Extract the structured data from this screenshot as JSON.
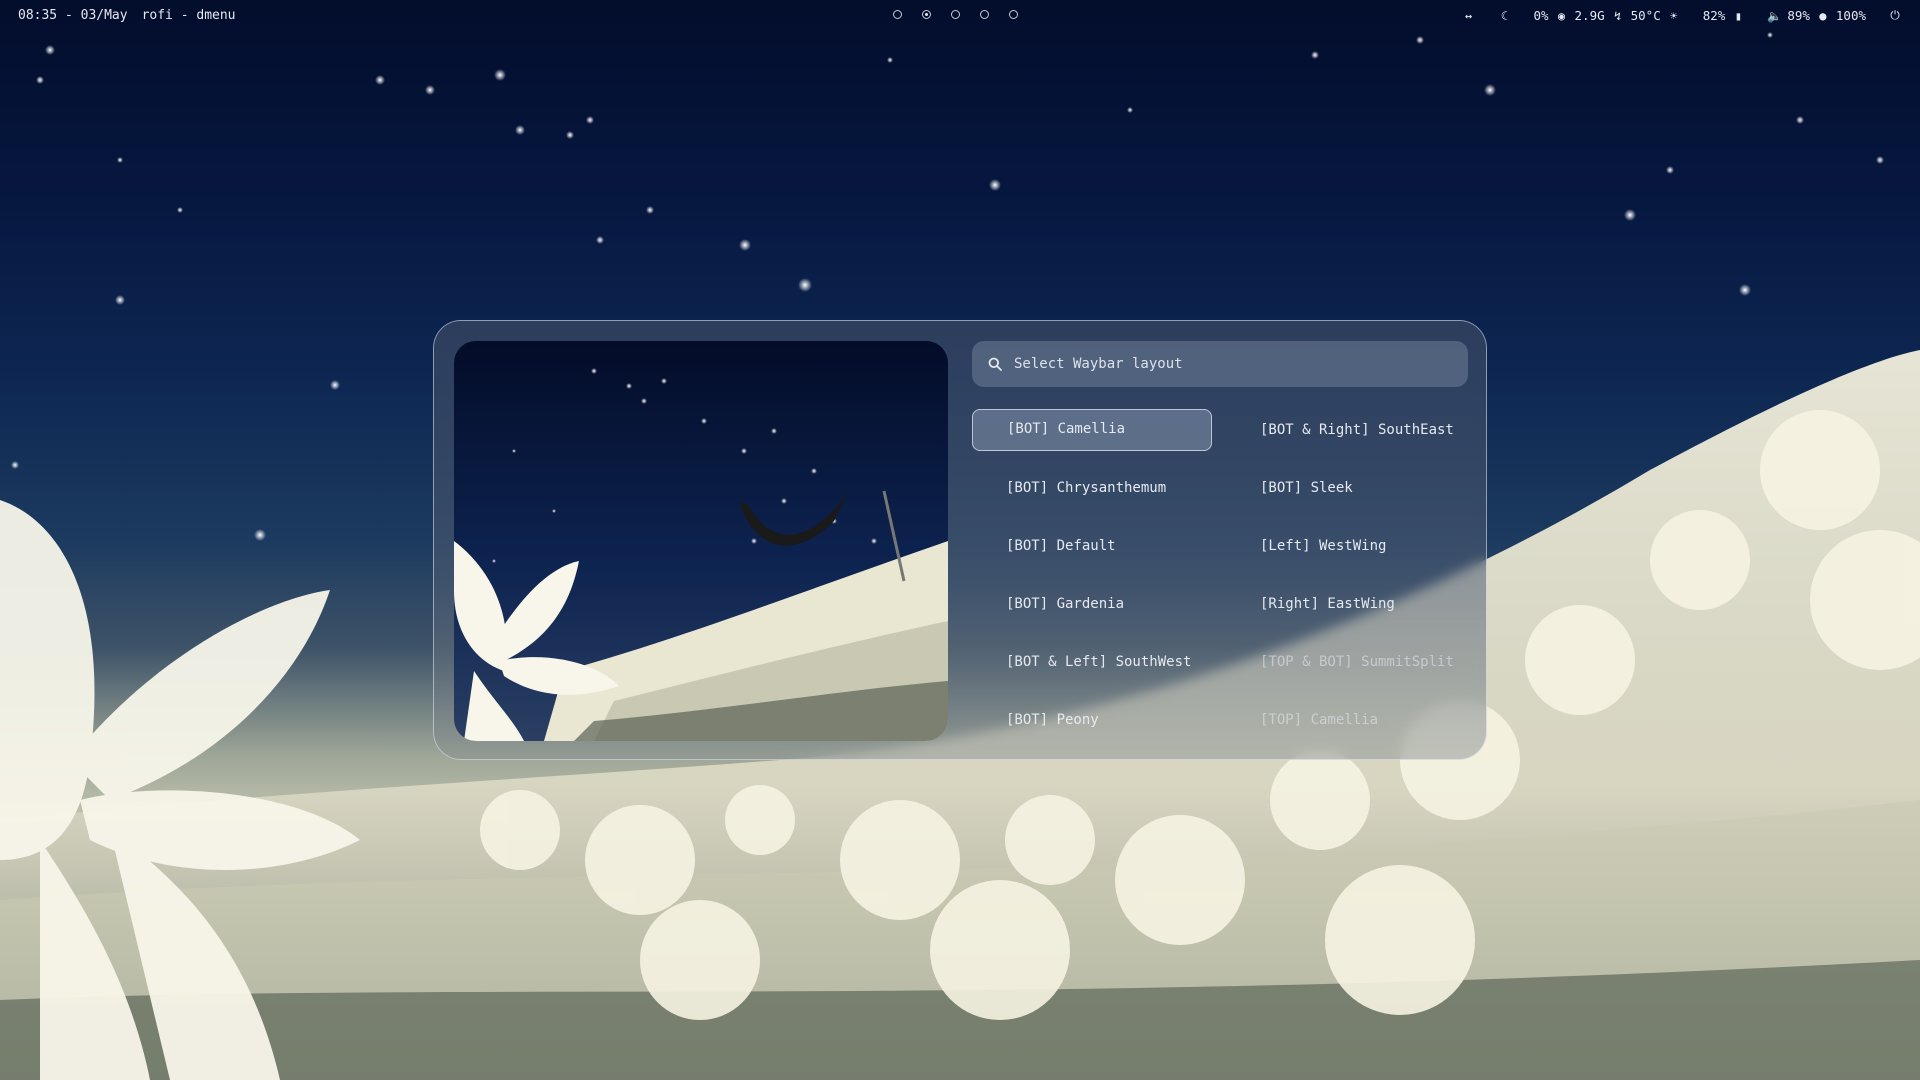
{
  "topbar": {
    "clock": "08:35 - 03/May",
    "window_class": "rofi - dmenu",
    "workspaces": [
      {
        "active": false
      },
      {
        "active": true
      },
      {
        "active": false
      },
      {
        "active": false
      },
      {
        "active": false
      }
    ],
    "status": {
      "cpu_usage": "0%",
      "memory": "2.9G",
      "temperature": "50°C",
      "brightness": "82%",
      "volume": "89%",
      "mic": "100%"
    },
    "icons": [
      "code-icon",
      "moon-icon",
      "cpu-icon",
      "memory-icon",
      "temperature-icon",
      "brightness-icon",
      "volume-icon",
      "mic-icon",
      "power-icon"
    ]
  },
  "rofi": {
    "search_placeholder": "Select Waybar layout",
    "items": [
      {
        "label": "[BOT] Camellia",
        "selected": true
      },
      {
        "label": "[BOT & Right] SouthEast"
      },
      {
        "label": "[BOT] Chrysanthemum"
      },
      {
        "label": "[BOT] Sleek"
      },
      {
        "label": "[BOT] Default"
      },
      {
        "label": "[Left] WestWing"
      },
      {
        "label": "[BOT] Gardenia"
      },
      {
        "label": "[Right] EastWing"
      },
      {
        "label": "[BOT & Left] SouthWest"
      },
      {
        "label": "[TOP & BOT] SummitSplit"
      },
      {
        "label": "[BOT] Peony"
      },
      {
        "label": "[TOP] Camellia"
      }
    ]
  },
  "colors": {
    "sky_top": "#030d2c",
    "sky_mid": "#0d2752",
    "flowers": "#e8e6cf",
    "text": "#e6e9ef",
    "selection_bg": "#8291aa"
  }
}
